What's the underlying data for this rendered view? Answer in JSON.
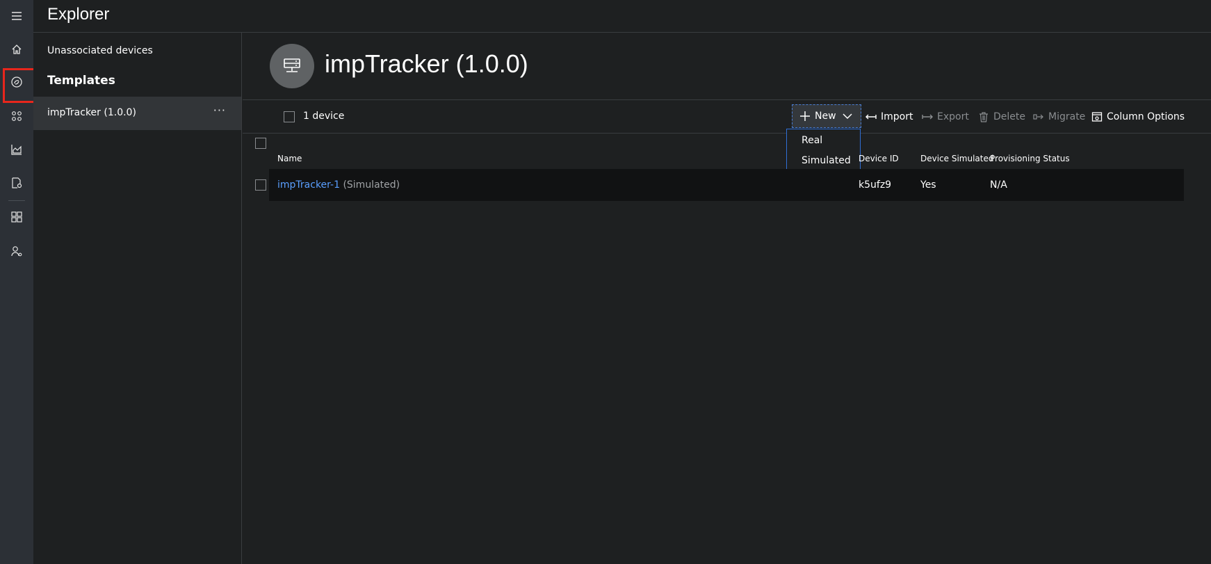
{
  "header": {
    "title": "Explorer"
  },
  "rail": {
    "icons": [
      "menu-icon",
      "home-icon",
      "device-explorer-icon",
      "device-sets-icon",
      "analytics-icon",
      "jobs-icon",
      "dashboard-icon",
      "administration-icon"
    ],
    "active_index": 2,
    "active_color": "#e8261c"
  },
  "panel": {
    "unassociated": "Unassociated devices",
    "heading": "Templates",
    "items": [
      {
        "label": "impTracker (1.0.0)",
        "more": "···"
      }
    ]
  },
  "main": {
    "title": "impTracker (1.0.0)",
    "toolbar": {
      "count": "1 device",
      "new_label": "New",
      "import_label": "Import",
      "export_label": "Export",
      "delete_label": "Delete",
      "migrate_label": "Migrate",
      "column_options_label": "Column Options"
    },
    "new_menu": {
      "options": [
        "Real",
        "Simulated"
      ]
    },
    "table": {
      "columns": [
        "Name",
        "Device ID",
        "Device Simulated",
        "Provisioning Status"
      ],
      "rows": [
        {
          "name": "impTracker-1",
          "name_suffix": "(Simulated)",
          "device_id": "k5ufz9",
          "simulated": "Yes",
          "provisioning": "N/A"
        }
      ]
    },
    "colors": {
      "link": "#5a9fff",
      "accent_border": "#2f6fd6"
    }
  }
}
